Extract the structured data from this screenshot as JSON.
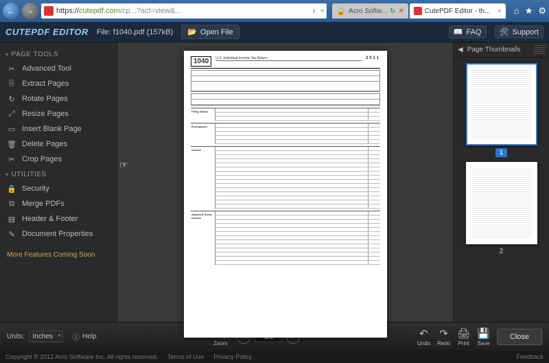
{
  "browser": {
    "url_prefix": "https://",
    "url_host": "cutepdf.com",
    "url_path": "/cp...?act=view&...",
    "search_hint": "♀",
    "tab_inactive": "Acro Softw...",
    "tab_active": "CutePDF Editor - th...",
    "refresh_glyph": "↻",
    "stop_glyph": "✕"
  },
  "header": {
    "logo": "CUTEPDF EDITOR",
    "file_label": "File: f1040.pdf (157kB)",
    "open_file": "Open File",
    "faq": "FAQ",
    "support": "Support"
  },
  "sidebar": {
    "sections": {
      "page_tools": "PAGE TOOLS",
      "utilities": "UTILITIES"
    },
    "page_tools": [
      {
        "icon": "✂",
        "label": "Advanced Tool"
      },
      {
        "icon": "⎘",
        "label": "Extract Pages"
      },
      {
        "icon": "↻",
        "label": "Rotate Pages"
      },
      {
        "icon": "⤢",
        "label": "Resize Pages"
      },
      {
        "icon": "▭",
        "label": "Insert Blank Page"
      },
      {
        "icon": "🗑",
        "label": "Delete Pages"
      },
      {
        "icon": "✂",
        "label": "Crop Pages"
      }
    ],
    "utilities": [
      {
        "icon": "🔒",
        "label": "Security"
      },
      {
        "icon": "⧉",
        "label": "Merge PDFs"
      },
      {
        "icon": "▤",
        "label": "Header & Footer"
      },
      {
        "icon": "✎",
        "label": "Document Properties"
      }
    ],
    "coming_soon": "More Features Coming Soon"
  },
  "document": {
    "form_number": "1040",
    "form_title": "U.S. Individual Income Tax Return",
    "form_year": "2011",
    "sections": [
      "Filing Status",
      "Exemptions",
      "Income",
      "Adjusted Gross Income"
    ]
  },
  "thumbs": {
    "title": "Page Thumbnails",
    "pages": [
      {
        "num": "1",
        "selected": true
      },
      {
        "num": "2",
        "selected": false
      }
    ]
  },
  "bottombar": {
    "units_label": "Units:",
    "units_value": "Inches",
    "help": "Help",
    "zoom": "Zoom",
    "page_indicator": "1/2",
    "undo": "Undo",
    "redo": "Redo",
    "print": "Print",
    "save": "Save",
    "close": "Close"
  },
  "footer": {
    "copyright": "Copyright © 2012 Acro Software Inc. All rights reserved.",
    "terms": "Terms of Use",
    "privacy": "Privacy Policy",
    "feedback": "Feedback"
  }
}
